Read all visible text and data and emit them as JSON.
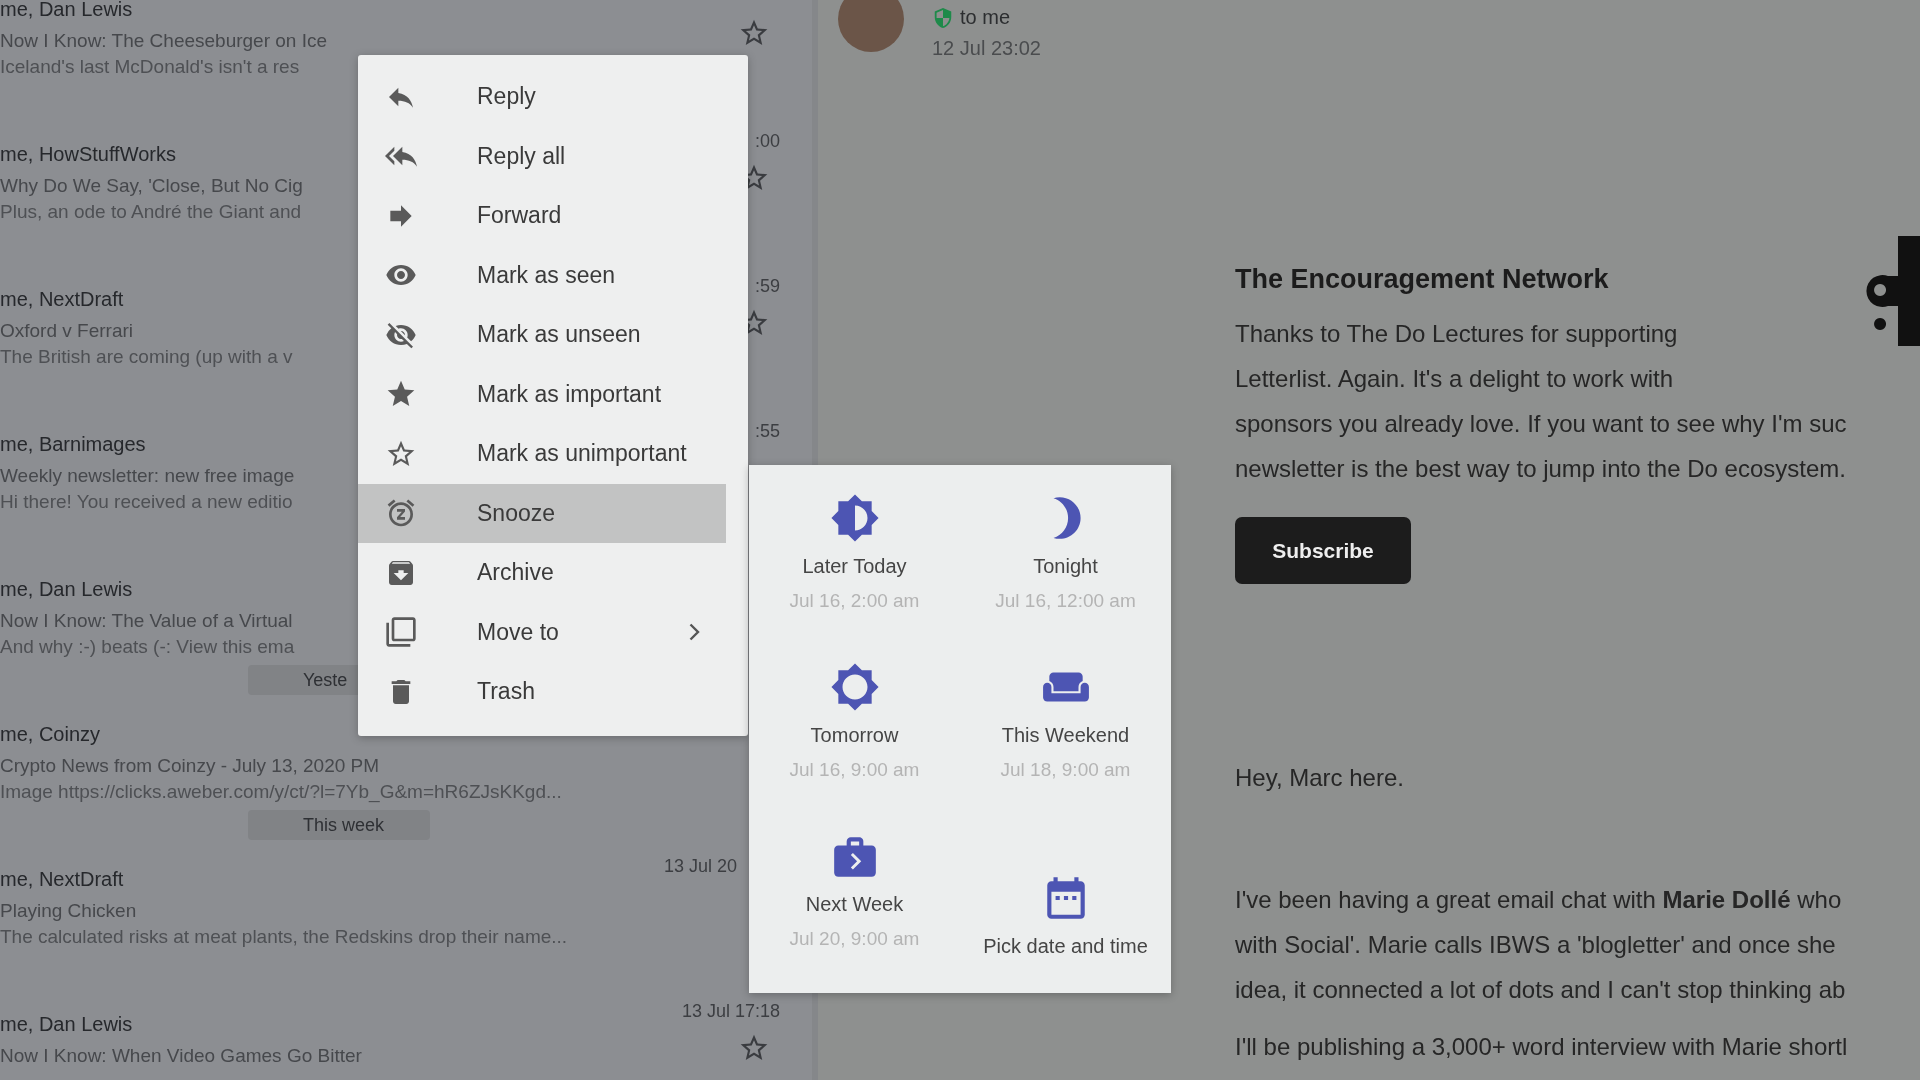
{
  "message_list": {
    "items": [
      {
        "kind": "message",
        "sender": "me, Dan Lewis",
        "subject": "Now I Know: The Cheeseburger on Ice",
        "preview": "Iceland's last McDonald's isn't a res",
        "starred": false
      },
      {
        "kind": "message",
        "sender": "me, HowStuffWorks",
        "subject": "Why Do We Say, 'Close, But No Cig",
        "preview": "Plus, an ode to André the Giant and",
        "time": ":00",
        "starred": false,
        "time_clipped": false
      },
      {
        "kind": "message",
        "sender": "me, NextDraft",
        "subject": "Oxford v Ferrari",
        "preview": "The British are coming (up with a v",
        "time": ":59",
        "starred": false,
        "time_clipped": false
      },
      {
        "kind": "message",
        "sender": "me, Barnimages",
        "subject": "Weekly newsletter: new free image",
        "preview": "Hi there! You received a new editio",
        "time": ":55",
        "time_clipped": false
      },
      {
        "kind": "message",
        "sender": "me, Dan Lewis",
        "subject": "Now I Know: The Value of a Virtual",
        "preview": "And why :-) beats (-:  View this ema"
      },
      {
        "kind": "separator",
        "label": "Yeste"
      },
      {
        "kind": "message",
        "sender": "me, Coinzy",
        "subject": "Crypto News from Coinzy - July 13, 2020 PM",
        "preview": "Image https://clicks.aweber.com/y/ct/?l=7Yb_G&m=hR6ZJsKKgd..."
      },
      {
        "kind": "separator",
        "label": "This week"
      },
      {
        "kind": "message",
        "sender": "me, NextDraft",
        "subject": "Playing Chicken",
        "preview": "The calculated risks at meat plants, the Redskins drop their name...",
        "time": "13 Jul 20",
        "time_clipped": true
      },
      {
        "kind": "message",
        "sender": "me, Dan Lewis",
        "subject": "Now I Know: When Video Games Go Bitter",
        "time": "13 Jul 17:18",
        "starred": false,
        "time_clipped": false
      }
    ]
  },
  "email_header": {
    "recipient": "to me",
    "date": "12 Jul 23:02"
  },
  "newsletter": {
    "heading": "The Encouragement Network",
    "intro_lines": [
      "Thanks to The Do Lectures for supporting",
      "Letterlist. Again. It's a delight to work with",
      "sponsors you already love. If you want to see why I'm suc",
      "newsletter is the best way to jump into the Do ecosystem."
    ],
    "button": "Subscribe",
    "greeting": "Hey, Marc here.",
    "body_lines": [
      "I've been having a great email chat with **Marie Dollé** who",
      "with Social'. Marie calls IBWS a 'blogletter' and once she",
      "idea, it connected a lot of dots and I can't stop thinking ab"
    ],
    "last_line": "I'll be publishing a 3,000+ word interview with Marie shortl"
  },
  "context_menu": {
    "items": [
      {
        "label": "Reply",
        "selected": false,
        "submenu": false
      },
      {
        "label": "Reply all",
        "selected": false,
        "submenu": false
      },
      {
        "label": "Forward",
        "selected": false,
        "submenu": false
      },
      {
        "label": "Mark as seen",
        "selected": false,
        "submenu": false
      },
      {
        "label": "Mark as unseen",
        "selected": false,
        "submenu": false
      },
      {
        "label": "Mark as important",
        "selected": false,
        "submenu": false
      },
      {
        "label": "Mark as unimportant",
        "selected": false,
        "submenu": false
      },
      {
        "label": "Snooze",
        "selected": true,
        "submenu": false
      },
      {
        "label": "Archive",
        "selected": false,
        "submenu": false
      },
      {
        "label": "Move to",
        "selected": false,
        "submenu": true
      },
      {
        "label": "Trash",
        "selected": false,
        "submenu": false
      }
    ]
  },
  "snooze_panel": {
    "options": [
      {
        "label": "Later Today",
        "time": "Jul 16, 2:00 am"
      },
      {
        "label": "Tonight",
        "time": "Jul 16, 12:00 am"
      },
      {
        "label": "Tomorrow",
        "time": "Jul 16, 9:00 am"
      },
      {
        "label": "This Weekend",
        "time": "Jul 18, 9:00 am"
      },
      {
        "label": "Next Week",
        "time": "Jul 20, 9:00 am"
      },
      {
        "label": "Pick date and time"
      }
    ]
  }
}
